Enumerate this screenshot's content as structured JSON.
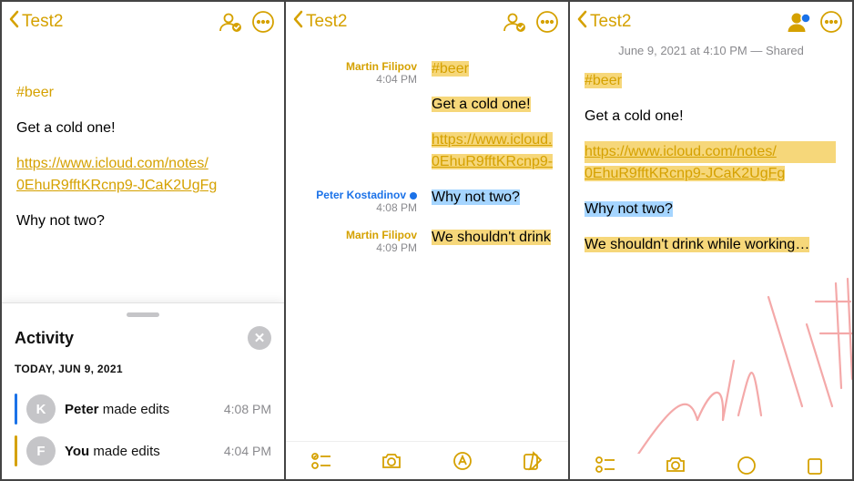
{
  "title": "Test2",
  "accent": "#d5a100",
  "note": {
    "tag": "#beer",
    "line1": "Get a cold one!",
    "url_l1": "https://www.icloud.com/notes/",
    "url_l2": "0EhuR9fftKRcnp9-JCaK2UgFg",
    "url_trunc_l1": "https://www.icloud.",
    "url_trunc_l2": "0EhuR9fftKRcnp9-",
    "line2": "Why not two?",
    "line3_trunc": "We shouldn't drink",
    "line3_full": "We shouldn't drink while working…"
  },
  "attrib": [
    {
      "name": "Martin Filipov",
      "time": "4:04 PM",
      "color": "y"
    },
    {
      "name": "Peter Kostadinov",
      "time": "4:08 PM",
      "color": "b"
    },
    {
      "name": "Martin Filipov",
      "time": "4:09 PM",
      "color": "y"
    }
  ],
  "timestamp_line": "June 9, 2021 at 4:10 PM — Shared",
  "activity": {
    "title": "Activity",
    "date_header": "TODAY, JUN 9, 2021",
    "rows": [
      {
        "bar": "b",
        "initial": "K",
        "who": "Peter",
        "verb": " made edits",
        "time": "4:08 PM"
      },
      {
        "bar": "y",
        "initial": "F",
        "who": "You",
        "verb": " made edits",
        "time": "4:04 PM"
      }
    ]
  }
}
